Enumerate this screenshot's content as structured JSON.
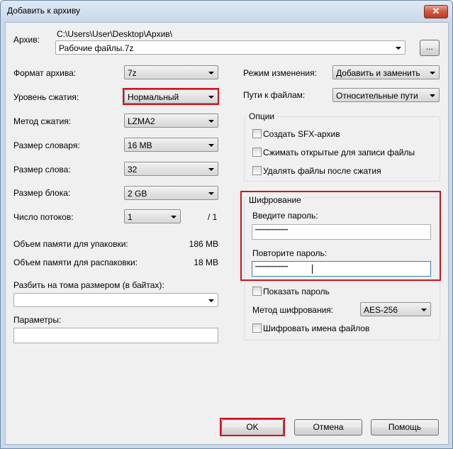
{
  "window": {
    "title": "Добавить к архиву",
    "close_glyph": "✕"
  },
  "archive": {
    "label": "Архив:",
    "path": "C:\\Users\\User\\Desktop\\Архив\\",
    "filename": "Рабочие файлы.7z",
    "browse_label": "..."
  },
  "left": {
    "format": {
      "label": "Формат архива:",
      "value": "7z"
    },
    "level": {
      "label": "Уровень сжатия:",
      "value": "Нормальный"
    },
    "method": {
      "label": "Метод сжатия:",
      "value": "LZMA2"
    },
    "dict": {
      "label": "Размер словаря:",
      "value": "16 MB"
    },
    "word": {
      "label": "Размер слова:",
      "value": "32"
    },
    "block": {
      "label": "Размер блока:",
      "value": "2 GB"
    },
    "threads": {
      "label": "Число потоков:",
      "value": "1",
      "max": "/ 1"
    },
    "mem_pack": {
      "label": "Объем памяти для упаковки:",
      "value": "186 MB"
    },
    "mem_unpack": {
      "label": "Объем памяти для распаковки:",
      "value": "18 MB"
    },
    "split": {
      "label": "Разбить на тома размером (в байтах):",
      "value": ""
    },
    "params": {
      "label": "Параметры:",
      "value": ""
    }
  },
  "right": {
    "update_mode": {
      "label": "Режим изменения:",
      "value": "Добавить и заменить"
    },
    "path_mode": {
      "label": "Пути к файлам:",
      "value": "Относительные пути"
    },
    "options": {
      "title": "Опции",
      "items": [
        {
          "label": "Создать SFX-архив",
          "checked": false
        },
        {
          "label": "Сжимать открытые для записи файлы",
          "checked": false
        },
        {
          "label": "Удалять файлы после сжатия",
          "checked": false
        }
      ]
    },
    "encryption": {
      "title": "Шифрование",
      "password_label": "Введите пароль:",
      "password_value": "••••••••••••••••••••••",
      "repeat_label": "Повторите пароль:",
      "repeat_value": "••••••••••••••••••••••",
      "show_password": "Показать пароль",
      "method_label": "Метод шифрования:",
      "method_value": "AES-256",
      "encrypt_names": "Шифровать имена файлов"
    }
  },
  "buttons": {
    "ok": "OK",
    "cancel": "Отмена",
    "help": "Помощь"
  },
  "colors": {
    "highlight": "#d0121f"
  }
}
